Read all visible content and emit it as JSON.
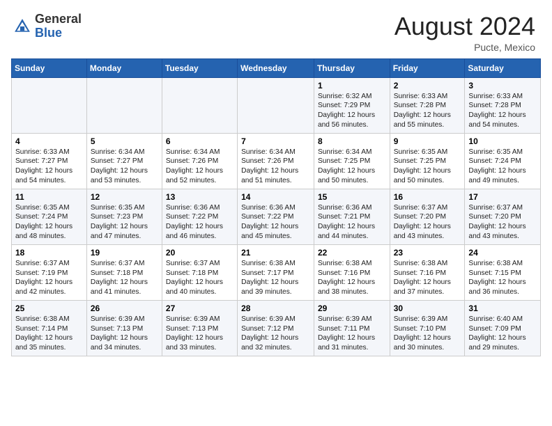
{
  "header": {
    "logo_general": "General",
    "logo_blue": "Blue",
    "month_title": "August 2024",
    "location": "Pucte, Mexico"
  },
  "days_of_week": [
    "Sunday",
    "Monday",
    "Tuesday",
    "Wednesday",
    "Thursday",
    "Friday",
    "Saturday"
  ],
  "weeks": [
    [
      {
        "day": "",
        "info": ""
      },
      {
        "day": "",
        "info": ""
      },
      {
        "day": "",
        "info": ""
      },
      {
        "day": "",
        "info": ""
      },
      {
        "day": "1",
        "info": "Sunrise: 6:32 AM\nSunset: 7:29 PM\nDaylight: 12 hours and 56 minutes."
      },
      {
        "day": "2",
        "info": "Sunrise: 6:33 AM\nSunset: 7:28 PM\nDaylight: 12 hours and 55 minutes."
      },
      {
        "day": "3",
        "info": "Sunrise: 6:33 AM\nSunset: 7:28 PM\nDaylight: 12 hours and 54 minutes."
      }
    ],
    [
      {
        "day": "4",
        "info": "Sunrise: 6:33 AM\nSunset: 7:27 PM\nDaylight: 12 hours and 54 minutes."
      },
      {
        "day": "5",
        "info": "Sunrise: 6:34 AM\nSunset: 7:27 PM\nDaylight: 12 hours and 53 minutes."
      },
      {
        "day": "6",
        "info": "Sunrise: 6:34 AM\nSunset: 7:26 PM\nDaylight: 12 hours and 52 minutes."
      },
      {
        "day": "7",
        "info": "Sunrise: 6:34 AM\nSunset: 7:26 PM\nDaylight: 12 hours and 51 minutes."
      },
      {
        "day": "8",
        "info": "Sunrise: 6:34 AM\nSunset: 7:25 PM\nDaylight: 12 hours and 50 minutes."
      },
      {
        "day": "9",
        "info": "Sunrise: 6:35 AM\nSunset: 7:25 PM\nDaylight: 12 hours and 50 minutes."
      },
      {
        "day": "10",
        "info": "Sunrise: 6:35 AM\nSunset: 7:24 PM\nDaylight: 12 hours and 49 minutes."
      }
    ],
    [
      {
        "day": "11",
        "info": "Sunrise: 6:35 AM\nSunset: 7:24 PM\nDaylight: 12 hours and 48 minutes."
      },
      {
        "day": "12",
        "info": "Sunrise: 6:35 AM\nSunset: 7:23 PM\nDaylight: 12 hours and 47 minutes."
      },
      {
        "day": "13",
        "info": "Sunrise: 6:36 AM\nSunset: 7:22 PM\nDaylight: 12 hours and 46 minutes."
      },
      {
        "day": "14",
        "info": "Sunrise: 6:36 AM\nSunset: 7:22 PM\nDaylight: 12 hours and 45 minutes."
      },
      {
        "day": "15",
        "info": "Sunrise: 6:36 AM\nSunset: 7:21 PM\nDaylight: 12 hours and 44 minutes."
      },
      {
        "day": "16",
        "info": "Sunrise: 6:37 AM\nSunset: 7:20 PM\nDaylight: 12 hours and 43 minutes."
      },
      {
        "day": "17",
        "info": "Sunrise: 6:37 AM\nSunset: 7:20 PM\nDaylight: 12 hours and 43 minutes."
      }
    ],
    [
      {
        "day": "18",
        "info": "Sunrise: 6:37 AM\nSunset: 7:19 PM\nDaylight: 12 hours and 42 minutes."
      },
      {
        "day": "19",
        "info": "Sunrise: 6:37 AM\nSunset: 7:18 PM\nDaylight: 12 hours and 41 minutes."
      },
      {
        "day": "20",
        "info": "Sunrise: 6:37 AM\nSunset: 7:18 PM\nDaylight: 12 hours and 40 minutes."
      },
      {
        "day": "21",
        "info": "Sunrise: 6:38 AM\nSunset: 7:17 PM\nDaylight: 12 hours and 39 minutes."
      },
      {
        "day": "22",
        "info": "Sunrise: 6:38 AM\nSunset: 7:16 PM\nDaylight: 12 hours and 38 minutes."
      },
      {
        "day": "23",
        "info": "Sunrise: 6:38 AM\nSunset: 7:16 PM\nDaylight: 12 hours and 37 minutes."
      },
      {
        "day": "24",
        "info": "Sunrise: 6:38 AM\nSunset: 7:15 PM\nDaylight: 12 hours and 36 minutes."
      }
    ],
    [
      {
        "day": "25",
        "info": "Sunrise: 6:38 AM\nSunset: 7:14 PM\nDaylight: 12 hours and 35 minutes."
      },
      {
        "day": "26",
        "info": "Sunrise: 6:39 AM\nSunset: 7:13 PM\nDaylight: 12 hours and 34 minutes."
      },
      {
        "day": "27",
        "info": "Sunrise: 6:39 AM\nSunset: 7:13 PM\nDaylight: 12 hours and 33 minutes."
      },
      {
        "day": "28",
        "info": "Sunrise: 6:39 AM\nSunset: 7:12 PM\nDaylight: 12 hours and 32 minutes."
      },
      {
        "day": "29",
        "info": "Sunrise: 6:39 AM\nSunset: 7:11 PM\nDaylight: 12 hours and 31 minutes."
      },
      {
        "day": "30",
        "info": "Sunrise: 6:39 AM\nSunset: 7:10 PM\nDaylight: 12 hours and 30 minutes."
      },
      {
        "day": "31",
        "info": "Sunrise: 6:40 AM\nSunset: 7:09 PM\nDaylight: 12 hours and 29 minutes."
      }
    ]
  ]
}
